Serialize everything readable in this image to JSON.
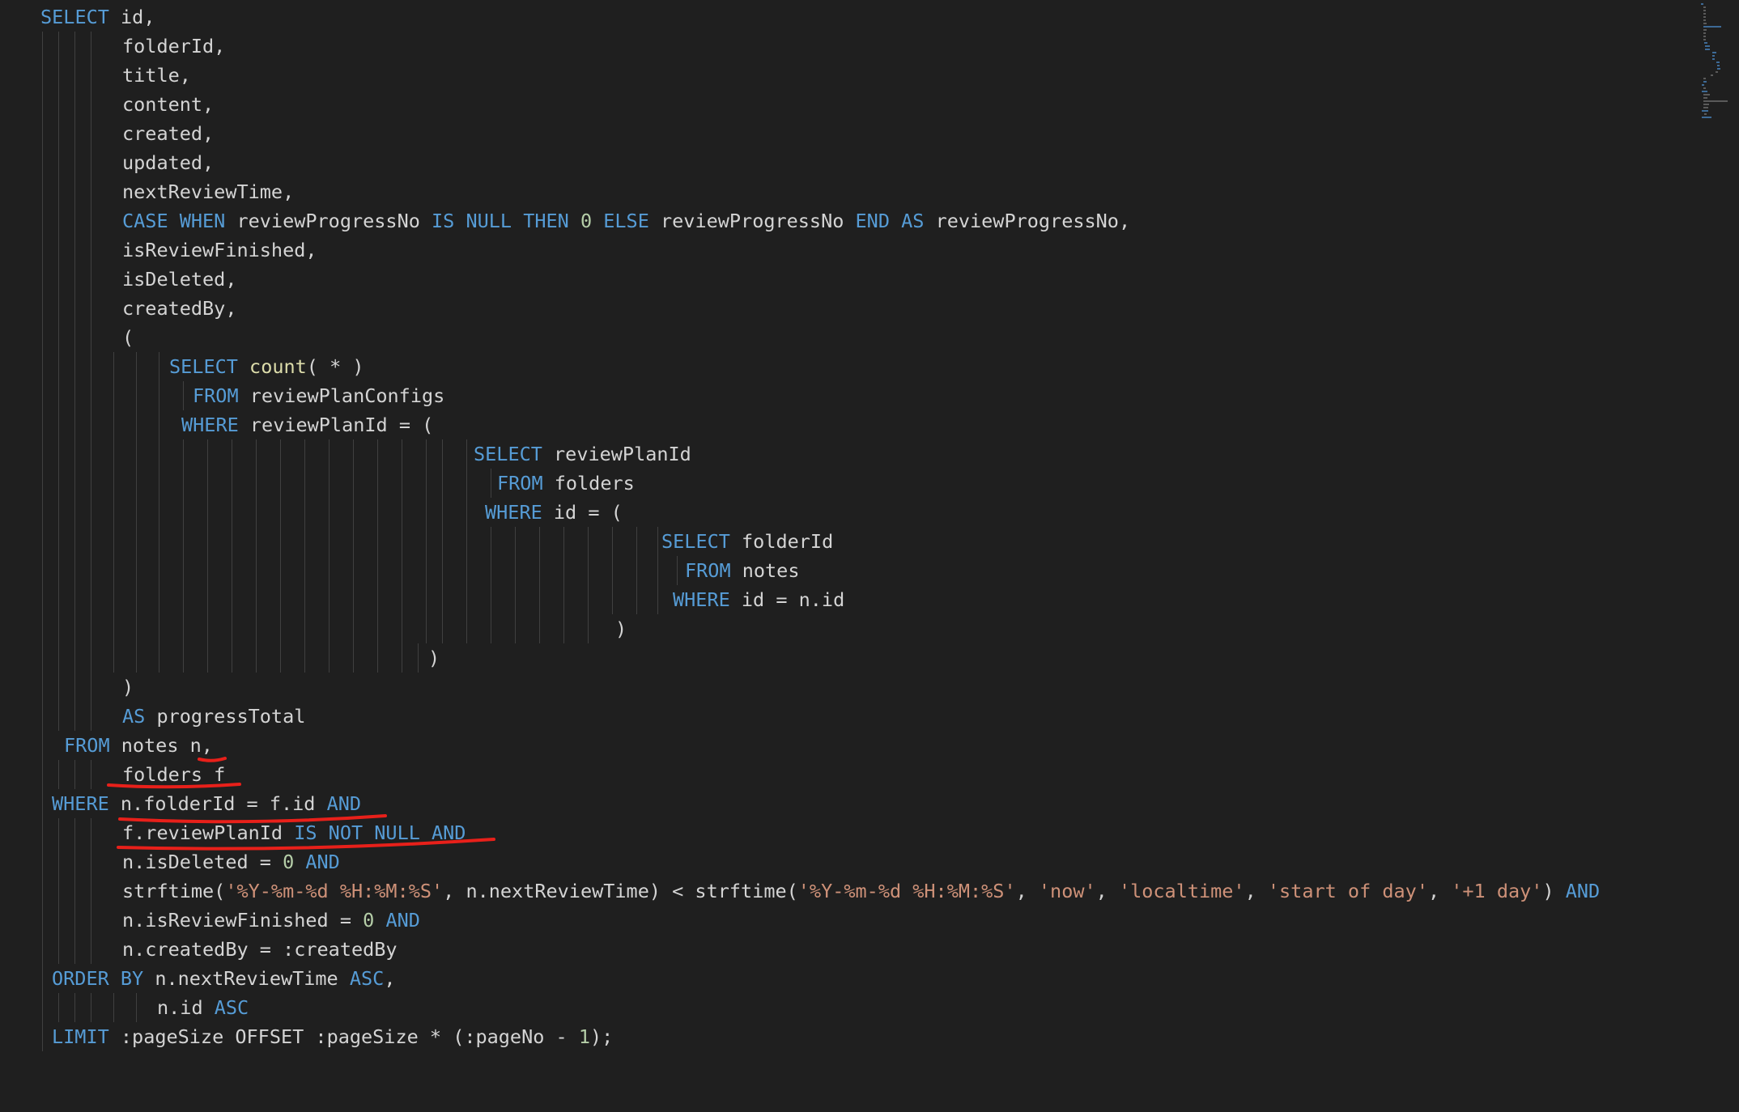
{
  "editor": {
    "language": "sql",
    "lines": [
      [
        {
          "t": "kw",
          "v": "SELECT"
        },
        {
          "t": "id",
          "v": " id,"
        }
      ],
      [
        {
          "t": "id",
          "v": "folderId,"
        }
      ],
      [
        {
          "t": "id",
          "v": "title,"
        }
      ],
      [
        {
          "t": "id",
          "v": "content,"
        }
      ],
      [
        {
          "t": "id",
          "v": "created,"
        }
      ],
      [
        {
          "t": "id",
          "v": "updated,"
        }
      ],
      [
        {
          "t": "id",
          "v": "nextReviewTime,"
        }
      ],
      [
        {
          "t": "kw",
          "v": "CASE WHEN"
        },
        {
          "t": "id",
          "v": " reviewProgressNo "
        },
        {
          "t": "kw",
          "v": "IS NULL THEN"
        },
        {
          "t": "id",
          "v": " "
        },
        {
          "t": "num",
          "v": "0"
        },
        {
          "t": "id",
          "v": " "
        },
        {
          "t": "kw",
          "v": "ELSE"
        },
        {
          "t": "id",
          "v": " reviewProgressNo "
        },
        {
          "t": "kw",
          "v": "END AS"
        },
        {
          "t": "id",
          "v": " reviewProgressNo,"
        }
      ],
      [
        {
          "t": "id",
          "v": "isReviewFinished,"
        }
      ],
      [
        {
          "t": "id",
          "v": "isDeleted,"
        }
      ],
      [
        {
          "t": "id",
          "v": "createdBy,"
        }
      ],
      [
        {
          "t": "id",
          "v": "("
        }
      ],
      [
        {
          "t": "kw",
          "v": "SELECT"
        },
        {
          "t": "id",
          "v": " "
        },
        {
          "t": "fn",
          "v": "count"
        },
        {
          "t": "id",
          "v": "( * )"
        }
      ],
      [
        {
          "t": "kw",
          "v": "FROM"
        },
        {
          "t": "id",
          "v": " reviewPlanConfigs"
        }
      ],
      [
        {
          "t": "kw",
          "v": "WHERE"
        },
        {
          "t": "id",
          "v": " reviewPlanId = ("
        }
      ],
      [
        {
          "t": "kw",
          "v": "SELECT"
        },
        {
          "t": "id",
          "v": " reviewPlanId"
        }
      ],
      [
        {
          "t": "kw",
          "v": "FROM"
        },
        {
          "t": "id",
          "v": " folders"
        }
      ],
      [
        {
          "t": "kw",
          "v": "WHERE"
        },
        {
          "t": "id",
          "v": " id = ("
        }
      ],
      [
        {
          "t": "kw",
          "v": "SELECT"
        },
        {
          "t": "id",
          "v": " folderId"
        }
      ],
      [
        {
          "t": "kw",
          "v": "FROM"
        },
        {
          "t": "id",
          "v": " notes"
        }
      ],
      [
        {
          "t": "kw",
          "v": "WHERE"
        },
        {
          "t": "id",
          "v": " id = n.id"
        }
      ],
      [
        {
          "t": "id",
          "v": ")"
        }
      ],
      [
        {
          "t": "id",
          "v": ")"
        }
      ],
      [
        {
          "t": "id",
          "v": ")"
        }
      ],
      [
        {
          "t": "kw",
          "v": "AS"
        },
        {
          "t": "id",
          "v": " progressTotal"
        }
      ],
      [
        {
          "t": "kw",
          "v": "FROM"
        },
        {
          "t": "id",
          "v": " notes n,"
        }
      ],
      [
        {
          "t": "id",
          "v": "folders f"
        }
      ],
      [
        {
          "t": "kw",
          "v": "WHERE"
        },
        {
          "t": "id",
          "v": " n.folderId = f.id "
        },
        {
          "t": "kw",
          "v": "AND"
        }
      ],
      [
        {
          "t": "id",
          "v": "f.reviewPlanId "
        },
        {
          "t": "kw",
          "v": "IS NOT NULL AND"
        }
      ],
      [
        {
          "t": "id",
          "v": "n.isDeleted = "
        },
        {
          "t": "num",
          "v": "0"
        },
        {
          "t": "id",
          "v": " "
        },
        {
          "t": "kw",
          "v": "AND"
        }
      ],
      [
        {
          "t": "id",
          "v": "strftime("
        },
        {
          "t": "str",
          "v": "'%Y-%m-%d %H:%M:%S'"
        },
        {
          "t": "id",
          "v": ", n.nextReviewTime) < strftime("
        },
        {
          "t": "str",
          "v": "'%Y-%m-%d %H:%M:%S'"
        },
        {
          "t": "id",
          "v": ", "
        },
        {
          "t": "str",
          "v": "'now'"
        },
        {
          "t": "id",
          "v": ", "
        },
        {
          "t": "str",
          "v": "'localtime'"
        },
        {
          "t": "id",
          "v": ", "
        },
        {
          "t": "str",
          "v": "'start of day'"
        },
        {
          "t": "id",
          "v": ", "
        },
        {
          "t": "str",
          "v": "'+1 day'"
        },
        {
          "t": "id",
          "v": ") "
        },
        {
          "t": "kw",
          "v": "AND"
        }
      ],
      [
        {
          "t": "id",
          "v": "n.isReviewFinished = "
        },
        {
          "t": "num",
          "v": "0"
        },
        {
          "t": "id",
          "v": " "
        },
        {
          "t": "kw",
          "v": "AND"
        }
      ],
      [
        {
          "t": "id",
          "v": "n.createdBy = :createdBy"
        }
      ],
      [
        {
          "t": "kw",
          "v": "ORDER BY"
        },
        {
          "t": "id",
          "v": " n.nextReviewTime "
        },
        {
          "t": "kw",
          "v": "ASC"
        },
        {
          "t": "id",
          "v": ","
        }
      ],
      [
        {
          "t": "id",
          "v": "n.id "
        },
        {
          "t": "kw",
          "v": "ASC"
        }
      ],
      [
        {
          "t": "kw",
          "v": "LIMIT"
        },
        {
          "t": "id",
          "v": " :pageSize OFFSET :pageSize * (:pageNo - "
        },
        {
          "t": "num",
          "v": "1"
        },
        {
          "t": "id",
          "v": ");"
        }
      ]
    ]
  },
  "colors": {
    "background": "#1f1f1f",
    "keyword": "#569cd6",
    "string": "#ce9178",
    "number": "#b5cea8",
    "function": "#dcdcaa",
    "identifier": "#d4d4d4",
    "annotation": "#e8201a"
  }
}
